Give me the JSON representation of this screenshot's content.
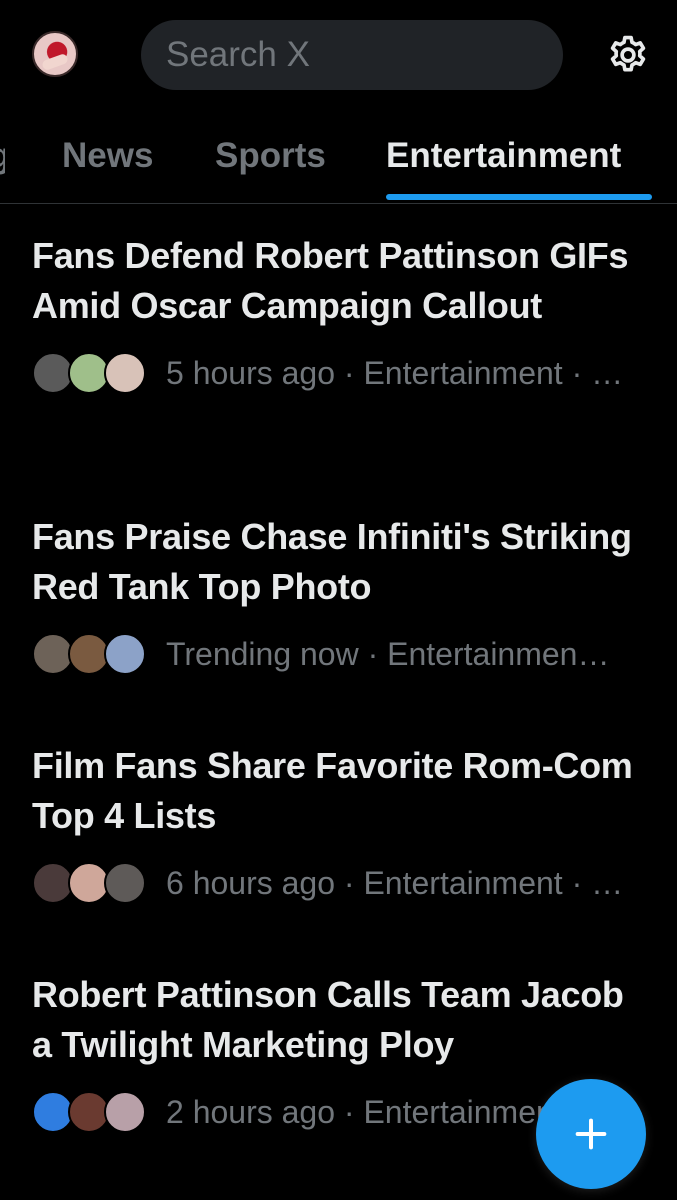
{
  "header": {
    "search_placeholder": "Search X",
    "avatar_icon": "profile-avatar",
    "settings_icon": "gear-icon"
  },
  "tabs": [
    {
      "label": "g",
      "active": false
    },
    {
      "label": "News",
      "active": false
    },
    {
      "label": "Sports",
      "active": false
    },
    {
      "label": "Entertainment",
      "active": true
    }
  ],
  "accent_color": "#1d9bf0",
  "trends": [
    {
      "title": "Fans Defend Robert Pattinson GIFs Amid Oscar Campaign Callout",
      "meta": "5 hours ago · Entertainment · …",
      "avatar_colors": [
        "#5a5a5a",
        "#9fbf8a",
        "#d8c2b8"
      ]
    },
    {
      "title": "Fans Praise Chase Infiniti's Striking Red Tank Top Photo",
      "meta": "Trending now · Entertainmen…",
      "avatar_colors": [
        "#6d6258",
        "#7a5a40",
        "#8ca2c8"
      ]
    },
    {
      "title": "Film Fans Share Favorite Rom-Com Top 4 Lists",
      "meta": "6 hours ago · Entertainment · …",
      "avatar_colors": [
        "#4a3a3a",
        "#cfa79a",
        "#5e5a58"
      ]
    },
    {
      "title": "Robert Pattinson Calls Team Jacob a Twilight Marketing Ploy",
      "meta": "2 hours ago · Entertainment · …",
      "avatar_colors": [
        "#2f7de0",
        "#6a3a30",
        "#b8a0a8"
      ]
    }
  ],
  "fab": {
    "icon": "plus-icon"
  }
}
